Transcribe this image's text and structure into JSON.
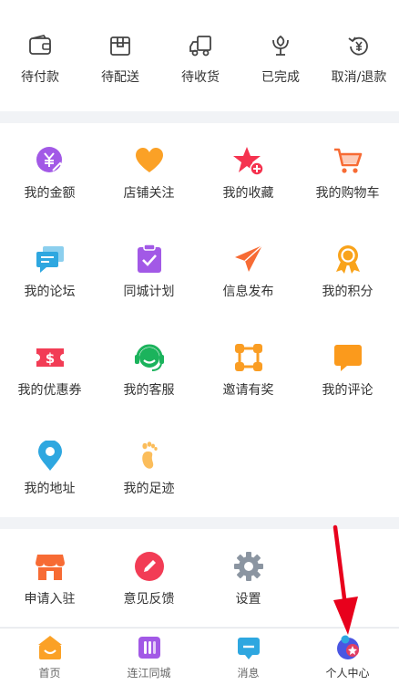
{
  "orders": [
    {
      "label": "待付款",
      "icon": "wallet-icon"
    },
    {
      "label": "待配送",
      "icon": "package-icon"
    },
    {
      "label": "待收货",
      "icon": "delivery-truck-icon"
    },
    {
      "label": "已完成",
      "icon": "flower-icon"
    },
    {
      "label": "取消/退款",
      "icon": "refund-icon"
    }
  ],
  "services": [
    {
      "label": "我的金额",
      "icon": "yuan-coin-icon",
      "color": "#a259e6"
    },
    {
      "label": "店铺关注",
      "icon": "heart-icon",
      "color": "#fba126"
    },
    {
      "label": "我的收藏",
      "icon": "star-add-icon",
      "color": "#f5334f"
    },
    {
      "label": "我的购物车",
      "icon": "shopping-cart-icon",
      "color": "#f76b34"
    },
    {
      "label": "我的论坛",
      "icon": "chat-bubbles-icon",
      "color": "#2ea7e0"
    },
    {
      "label": "同城计划",
      "icon": "clipboard-check-icon",
      "color": "#a259e6"
    },
    {
      "label": "信息发布",
      "icon": "paper-plane-icon",
      "color": "#f76b34"
    },
    {
      "label": "我的积分",
      "icon": "medal-icon",
      "color": "#f9a31b"
    },
    {
      "label": "我的优惠券",
      "icon": "coupon-icon",
      "color": "#f23c55"
    },
    {
      "label": "我的客服",
      "icon": "headset-icon",
      "color": "#1bb35c"
    },
    {
      "label": "邀请有奖",
      "icon": "network-icon",
      "color": "#fa9d23"
    },
    {
      "label": "我的评论",
      "icon": "comment-icon",
      "color": "#fb9a1c"
    },
    {
      "label": "我的地址",
      "icon": "location-pin-icon",
      "color": "#2ea7e0"
    },
    {
      "label": "我的足迹",
      "icon": "footprint-icon",
      "color": "#fbbd5b"
    }
  ],
  "extras": [
    {
      "label": "申请入驻",
      "icon": "storefront-icon",
      "color": "#f76b34"
    },
    {
      "label": "意见反馈",
      "icon": "pencil-icon",
      "color": "#f23c55"
    },
    {
      "label": "设置",
      "icon": "gear-icon",
      "color": "#8b95a1"
    }
  ],
  "tabbar": [
    {
      "label": "首页",
      "icon": "home-icon",
      "color": "#fba126"
    },
    {
      "label": "连江同城",
      "icon": "city-icon",
      "color": "#a259e6"
    },
    {
      "label": "消息",
      "icon": "message-icon",
      "color": "#2ea7e0"
    },
    {
      "label": "个人中心",
      "icon": "profile-icon",
      "color": "#4a56e2",
      "active": true
    }
  ],
  "annotation_color": "#e8001c"
}
